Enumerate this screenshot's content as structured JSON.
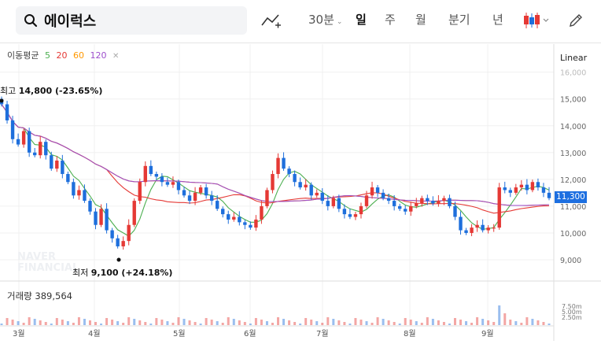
{
  "search": {
    "value": "에이럭스"
  },
  "toolbar": {
    "interval": "30분",
    "periods": [
      "일",
      "주",
      "월",
      "분기",
      "년"
    ],
    "active_period": "일"
  },
  "legend": {
    "label": "이동평균",
    "ma": [
      {
        "period": "5",
        "color": "#4caf50"
      },
      {
        "period": "20",
        "color": "#e53935"
      },
      {
        "period": "60",
        "color": "#ff9800"
      },
      {
        "period": "120",
        "color": "#9c4dcc"
      }
    ]
  },
  "scale_mode": "Linear",
  "price_axis": [
    "16,000",
    "15,000",
    "14,000",
    "13,000",
    "12,000",
    "11,000",
    "10,000",
    "9,000"
  ],
  "current_price": "11,300",
  "high_label": {
    "prefix": "최고",
    "value": "14,800 (-23.65%)"
  },
  "low_label": {
    "prefix": "최저",
    "value": "9,100 (+24.18%)"
  },
  "watermark": [
    "NAVER",
    "FINANCIAL"
  ],
  "volume": {
    "label": "거래량 389,564",
    "axis": [
      "7.50m",
      "5.00m",
      "2.50m"
    ]
  },
  "months": [
    "3월",
    "4월",
    "5월",
    "6월",
    "7월",
    "8월",
    "9월"
  ],
  "colors": {
    "up": "#e53935",
    "down": "#1e6fdc",
    "accent": "#1d6fe0"
  },
  "chart_data": {
    "type": "candlestick",
    "x": [
      "3월",
      "4월",
      "5월",
      "6월",
      "7월",
      "8월",
      "9월"
    ],
    "ylim": [
      8600,
      16000
    ],
    "close_approx": [
      14800,
      14200,
      13500,
      13300,
      13800,
      13000,
      12900,
      13400,
      12900,
      12400,
      12700,
      12200,
      11900,
      11400,
      11600,
      11200,
      10800,
      10300,
      10900,
      10100,
      9800,
      9500,
      9700,
      10300,
      11200,
      11900,
      12500,
      12200,
      12100,
      11900,
      11800,
      11900,
      11600,
      11400,
      11200,
      11500,
      11700,
      11400,
      11200,
      10900,
      10700,
      10500,
      10600,
      10400,
      10300,
      10200,
      10500,
      11000,
      11600,
      12200,
      12800,
      12400,
      12200,
      11900,
      11700,
      11800,
      11400,
      11500,
      11200,
      11000,
      11300,
      10900,
      10700,
      10600,
      10700,
      11000,
      11400,
      11700,
      11500,
      11300,
      11200,
      11000,
      10900,
      10800,
      11000,
      11100,
      11300,
      11200,
      11100,
      11200,
      11300,
      11000,
      10600,
      10100,
      10000,
      10200,
      10300,
      10100,
      10200,
      10200,
      11700,
      11600,
      11500,
      11700,
      11800,
      11600,
      11900,
      11700,
      11500,
      11300
    ]
  }
}
